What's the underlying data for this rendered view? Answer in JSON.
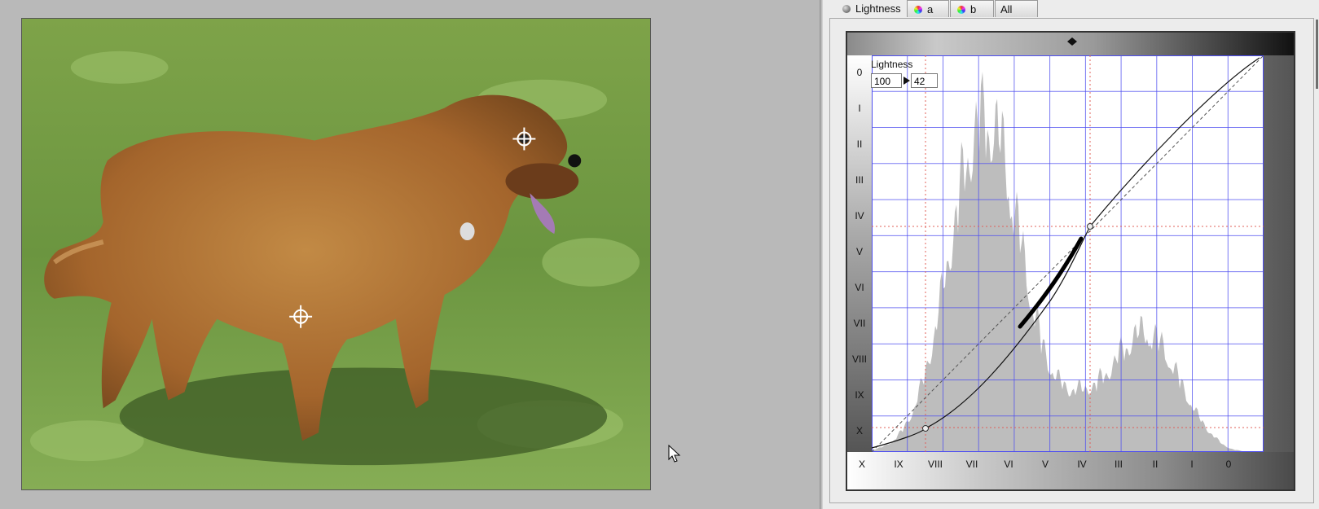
{
  "tabs": [
    {
      "label": "Lightness",
      "icon": "sphere-icon"
    },
    {
      "label": "a",
      "icon": "color-wheel-icon"
    },
    {
      "label": "b",
      "icon": "color-wheel-icon"
    },
    {
      "label": "All",
      "icon": ""
    }
  ],
  "curve": {
    "title": "Lightness",
    "input_value": "100",
    "output_value": "42",
    "zone_labels_y": [
      "0",
      "I",
      "II",
      "III",
      "IV",
      "V",
      "VI",
      "VII",
      "VIII",
      "IX",
      "X"
    ],
    "zone_labels_x": [
      "X",
      "IX",
      "VIII",
      "VII",
      "VI",
      "V",
      "IV",
      "III",
      "II",
      "I",
      "0"
    ],
    "colors": {
      "grid": "#4e4ef0",
      "guide": "#e0605a",
      "histogram": "#bdbdbd",
      "curve": "#111111"
    }
  },
  "photo": {
    "subject": "golden-retriever-dog-on-grass"
  }
}
